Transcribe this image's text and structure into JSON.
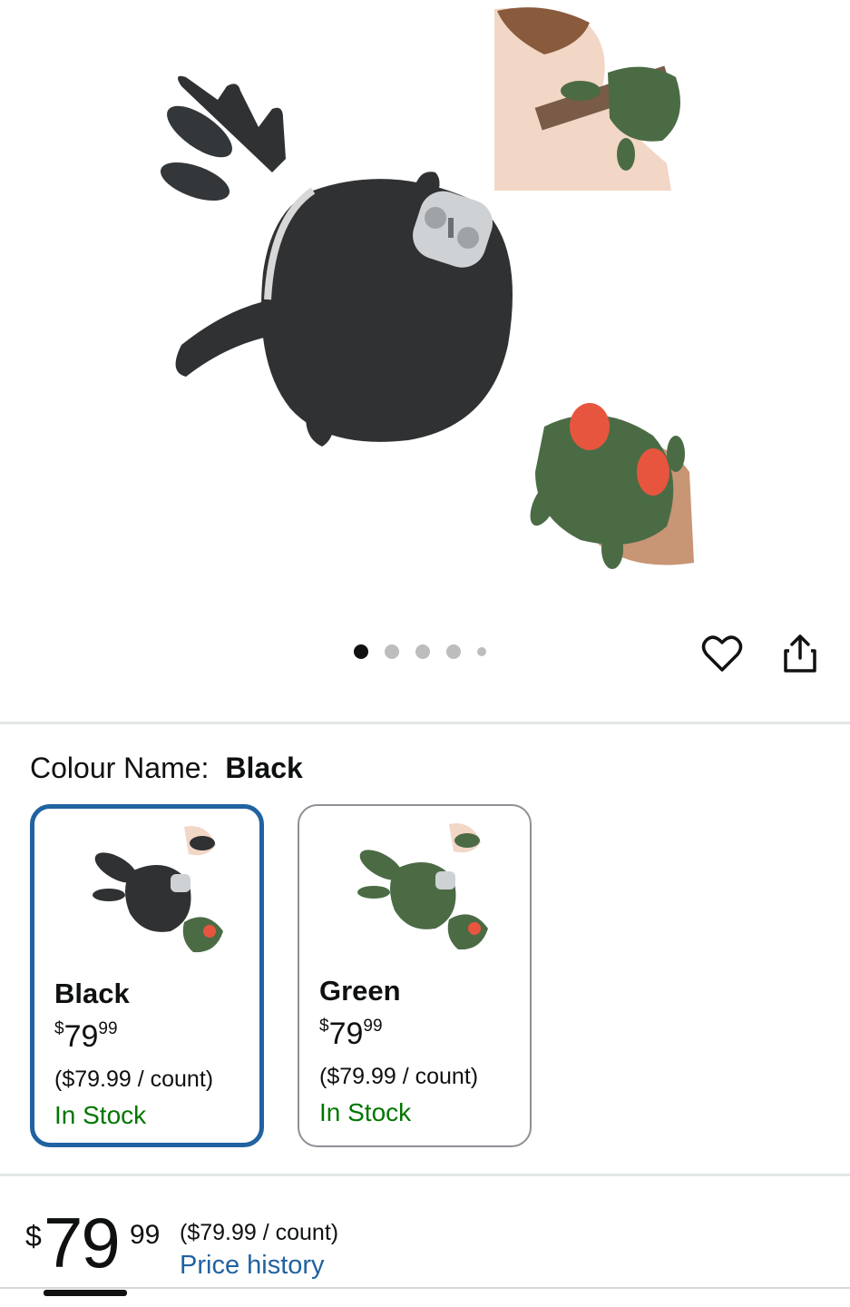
{
  "gallery": {
    "image_count": 5,
    "active_index": 0,
    "wishlist_icon": "heart-icon",
    "share_icon": "share-icon"
  },
  "colour": {
    "label": "Colour Name:",
    "selected": "Black"
  },
  "swatches": [
    {
      "name": "Black",
      "currency": "$",
      "whole": "79",
      "fraction": "99",
      "unit_price": "($79.99 / count)",
      "stock": "In Stock",
      "color": "#2f3133"
    },
    {
      "name": "Green",
      "currency": "$",
      "whole": "79",
      "fraction": "99",
      "unit_price": "($79.99 / count)",
      "stock": "In Stock",
      "color": "#4b6b45"
    }
  ],
  "price": {
    "currency": "$",
    "whole": "79",
    "fraction": "99",
    "unit_price": "($79.99 / count)",
    "history_link": "Price history"
  },
  "colors": {
    "accent": "#2162a1",
    "in_stock": "#007600",
    "product_black": "#2f3133",
    "product_green": "#4b6b45",
    "massage_nodes": "#e8553e"
  }
}
